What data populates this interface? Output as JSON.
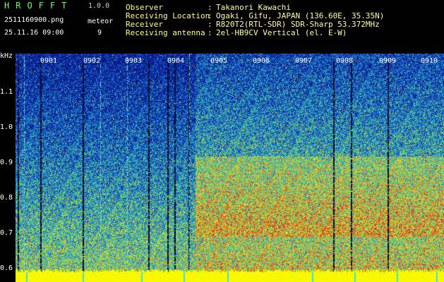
{
  "header": {
    "app_title": "HROFFT",
    "app_version": "1.0.0",
    "file_name": "2511160900.png",
    "file_date": "25.11.16 09:00",
    "mode_label": "meteor",
    "mode_value": "9"
  },
  "info": [
    {
      "key": "Observer",
      "sep": ":",
      "value": "Takanori Kawachi"
    },
    {
      "key": "Receiving Location",
      "sep": ":",
      "value": "Ogaki, Gifu, JAPAN (136.60E, 35.35N)"
    },
    {
      "key": "Receiver",
      "sep": ":",
      "value": "R820T2(RTL-SDR) SDR-Sharp 53.372MHz"
    },
    {
      "key": "Receiving antenna",
      "sep": ":",
      "value": "2el-HB9CV Vertical (el. E-W)"
    }
  ],
  "plot": {
    "y_unit": "kHz",
    "y_ticks": [
      "1.1",
      "1.0",
      "0.9",
      "0.8",
      "0.7",
      "0.6"
    ],
    "x_ticks": [
      "0901",
      "0902",
      "0903",
      "0904",
      "0905",
      "0906",
      "0907",
      "0908",
      "0909",
      "0910"
    ],
    "colors": {
      "background_low": "#0a2aa8",
      "noise_mid": "#28c8c8",
      "noise_high": "#f0e020",
      "hot": "#e02020",
      "baseline": "#f8f800"
    }
  }
}
